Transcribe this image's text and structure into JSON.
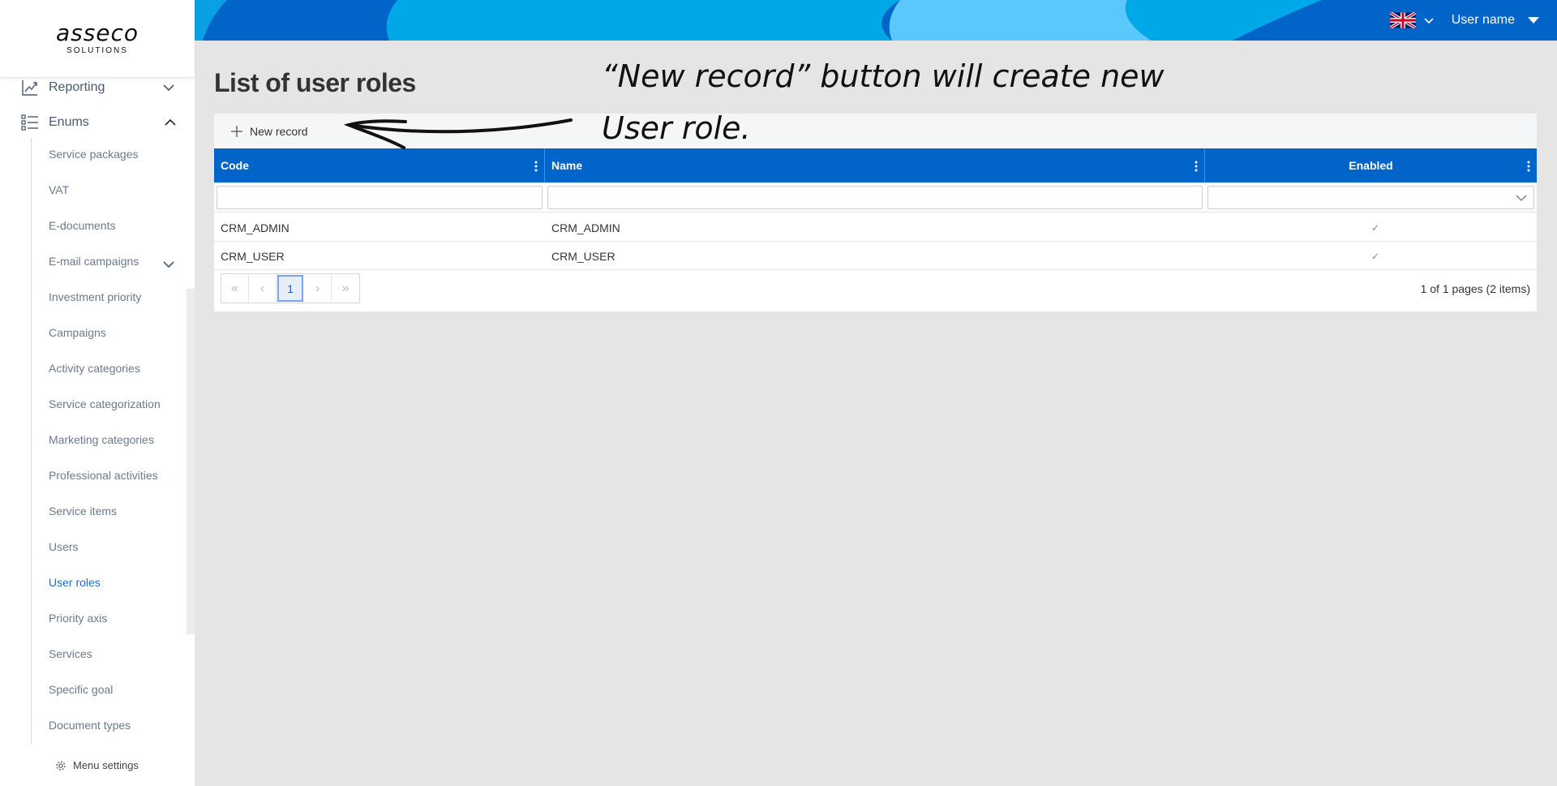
{
  "logo": {
    "main": "asseco",
    "sub": "SOLUTIONS"
  },
  "sidebar": {
    "top_items": [
      {
        "label": "Reporting",
        "icon": "chart-line-icon",
        "expanded": false
      },
      {
        "label": "Enums",
        "icon": "list-icon",
        "expanded": true
      }
    ],
    "sub_items": [
      "Service packages",
      "VAT",
      "E-documents",
      "E-mail campaigns",
      "Investment priority",
      "Campaigns",
      "Activity categories",
      "Service categorization",
      "Marketing categories",
      "Professional activities",
      "Service items",
      "Users",
      "User roles",
      "Priority axis",
      "Services",
      "Specific goal",
      "Document types"
    ],
    "active_item": "User roles",
    "menu_settings": "Menu settings"
  },
  "header": {
    "language_flag": "uk-flag-icon",
    "user_name": "User name"
  },
  "page": {
    "title": "List of user roles",
    "annotation": "“New record” button will create new User role."
  },
  "grid": {
    "toolbar": {
      "new_record_label": "New record"
    },
    "columns": [
      "Code",
      "Name",
      "Enabled"
    ],
    "rows": [
      {
        "code": "CRM_ADMIN",
        "name": "CRM_ADMIN",
        "enabled": "✓"
      },
      {
        "code": "CRM_USER",
        "name": "CRM_USER",
        "enabled": "✓"
      }
    ],
    "pager": {
      "current_page": "1",
      "info": "1 of 1 pages (2 items)"
    }
  },
  "colors": {
    "header_blue": "#0064c8",
    "accent_light": "#00a8e8",
    "active_link": "#1f6fbf"
  }
}
